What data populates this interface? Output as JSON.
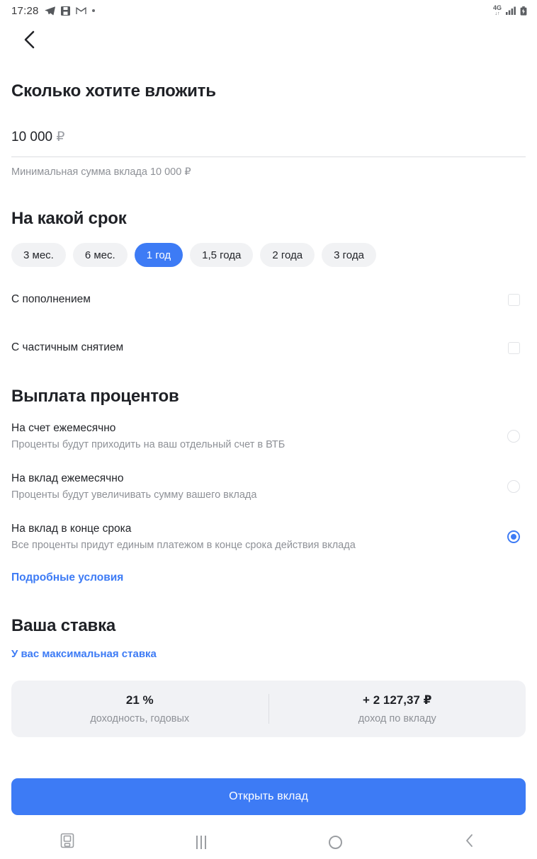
{
  "statusbar": {
    "time": "17:28",
    "left_icons": [
      "telegram-icon",
      "save-icon",
      "gmail-icon",
      "dot-icon"
    ],
    "network": "4G",
    "right_icons": [
      "signal-icon",
      "battery-icon"
    ]
  },
  "topbar": {
    "back_icon": "chevron-left-icon"
  },
  "invest": {
    "title": "Сколько хотите вложить",
    "amount": "10 000",
    "currency": "₽",
    "placeholder": "10 000 ₽",
    "hint": "Минимальная сумма вклада 10 000 ₽"
  },
  "term": {
    "title": "На какой срок",
    "options": [
      {
        "label": "3 мес.",
        "selected": false
      },
      {
        "label": "6 мес.",
        "selected": false
      },
      {
        "label": "1 год",
        "selected": true
      },
      {
        "label": "1,5 года",
        "selected": false
      },
      {
        "label": "2 года",
        "selected": false
      },
      {
        "label": "3 года",
        "selected": false
      }
    ]
  },
  "toggles": [
    {
      "label": "С пополнением",
      "checked": false
    },
    {
      "label": "С частичным снятием",
      "checked": false
    }
  ],
  "payout": {
    "title": "Выплата процентов",
    "options": [
      {
        "title": "На счет ежемесячно",
        "subtitle": "Проценты будут приходить на ваш отдельный счет в ВТБ",
        "selected": false
      },
      {
        "title": "На вклад ежемесячно",
        "subtitle": "Проценты будут увеличивать сумму вашего вклада",
        "selected": false
      },
      {
        "title": "На вклад в конце срока",
        "subtitle": "Все проценты придут единым платежом в конце срока действия вклада",
        "selected": true
      }
    ],
    "terms_link": "Подробные условия"
  },
  "rate": {
    "title": "Ваша ставка",
    "max_rate_note": "У вас максимальная ставка",
    "result": [
      {
        "value": "21 %",
        "label": "доходность, годовых"
      },
      {
        "value": "+ 2 127,37 ₽",
        "label": "доход по вкладу"
      }
    ]
  },
  "cta": {
    "label": "Открыть вклад"
  },
  "navbar": {
    "items": [
      "screenshot-icon",
      "recents-icon",
      "home-icon",
      "back-icon"
    ]
  },
  "colors": {
    "accent": "#3d7bf5",
    "text_primary": "#23252a",
    "text_muted": "#8e9197",
    "chip_bg": "#f1f2f4",
    "card_bg": "#f1f2f5"
  }
}
